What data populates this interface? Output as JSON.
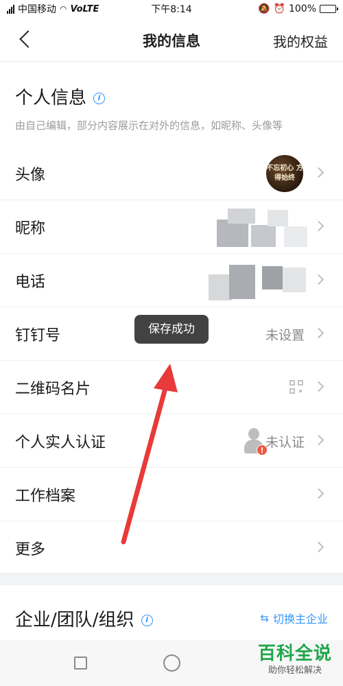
{
  "status_bar": {
    "carrier": "中国移动",
    "network": "VoLTE",
    "time": "下午8:14",
    "battery": "100%",
    "battery_level": 1.0
  },
  "navbar": {
    "title": "我的信息",
    "right_link": "我的权益"
  },
  "personal_section": {
    "title": "个人信息",
    "info_icon_glyph": "i",
    "subtitle": "由自己编辑，部分内容展示在对外的信息，如昵称、头像等"
  },
  "rows": [
    {
      "label": "头像",
      "avatar_text": "不忘初心 方得始终"
    },
    {
      "label": "昵称"
    },
    {
      "label": "电话"
    },
    {
      "label": "钉钉号",
      "value": "未设置"
    },
    {
      "label": "二维码名片"
    },
    {
      "label": "个人实人认证",
      "value": "未认证",
      "alert_glyph": "!"
    },
    {
      "label": "工作档案"
    },
    {
      "label": "更多"
    }
  ],
  "org_section": {
    "title": "企业/团队/组织",
    "info_icon_glyph": "i",
    "switch_icon": "⇆",
    "switch_label": "切换主企业"
  },
  "toast": {
    "message": "保存成功"
  },
  "annotation": {
    "arrow_color": "#e83a3a"
  },
  "watermark": {
    "title": "百科全说",
    "subtitle": "助你轻松解决"
  },
  "colors": {
    "accent": "#3296fa",
    "alert": "#f25643",
    "watermark": "#1fa74a"
  }
}
